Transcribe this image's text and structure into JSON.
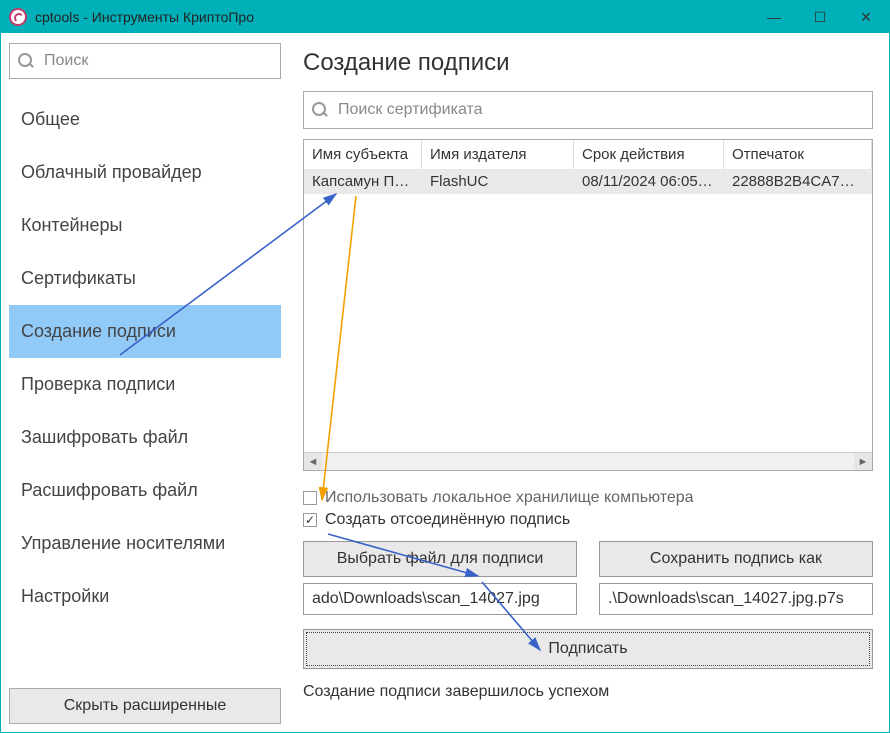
{
  "window": {
    "title": "cptools - Инструменты КриптоПро"
  },
  "sidebar": {
    "search_placeholder": "Поиск",
    "items": [
      {
        "label": "Общее"
      },
      {
        "label": "Облачный провайдер"
      },
      {
        "label": "Контейнеры"
      },
      {
        "label": "Сертификаты"
      },
      {
        "label": "Создание подписи"
      },
      {
        "label": "Проверка подписи"
      },
      {
        "label": "Зашифровать файл"
      },
      {
        "label": "Расшифровать файл"
      },
      {
        "label": "Управление носителями"
      },
      {
        "label": "Настройки"
      }
    ],
    "active_index": 4,
    "hide_advanced": "Скрыть расширенные"
  },
  "main": {
    "heading": "Создание подписи",
    "cert_search_placeholder": "Поиск сертификата",
    "table": {
      "columns": {
        "subject": "Имя субъекта",
        "issuer": "Имя издателя",
        "validity": "Срок действия",
        "thumbprint": "Отпечаток"
      },
      "rows": [
        {
          "subject": "Капсамун Пр…",
          "issuer": "FlashUC",
          "validity": "08/11/2024 06:05:…",
          "thumbprint": "22888B2B4CA7A4…"
        }
      ]
    },
    "options": {
      "use_local_store": {
        "label": "Использовать локальное хранилище компьютера",
        "checked": false
      },
      "detached_sig": {
        "label": "Создать отсоединённую подпись",
        "checked": true
      }
    },
    "buttons": {
      "choose_file": "Выбрать файл для подписи",
      "save_as": "Сохранить подпись как",
      "sign": "Подписать"
    },
    "paths": {
      "source": "ado\\Downloads\\scan_14027.jpg",
      "output": ".\\Downloads\\scan_14027.jpg.p7s"
    },
    "status": "Создание подписи завершилось успехом"
  }
}
